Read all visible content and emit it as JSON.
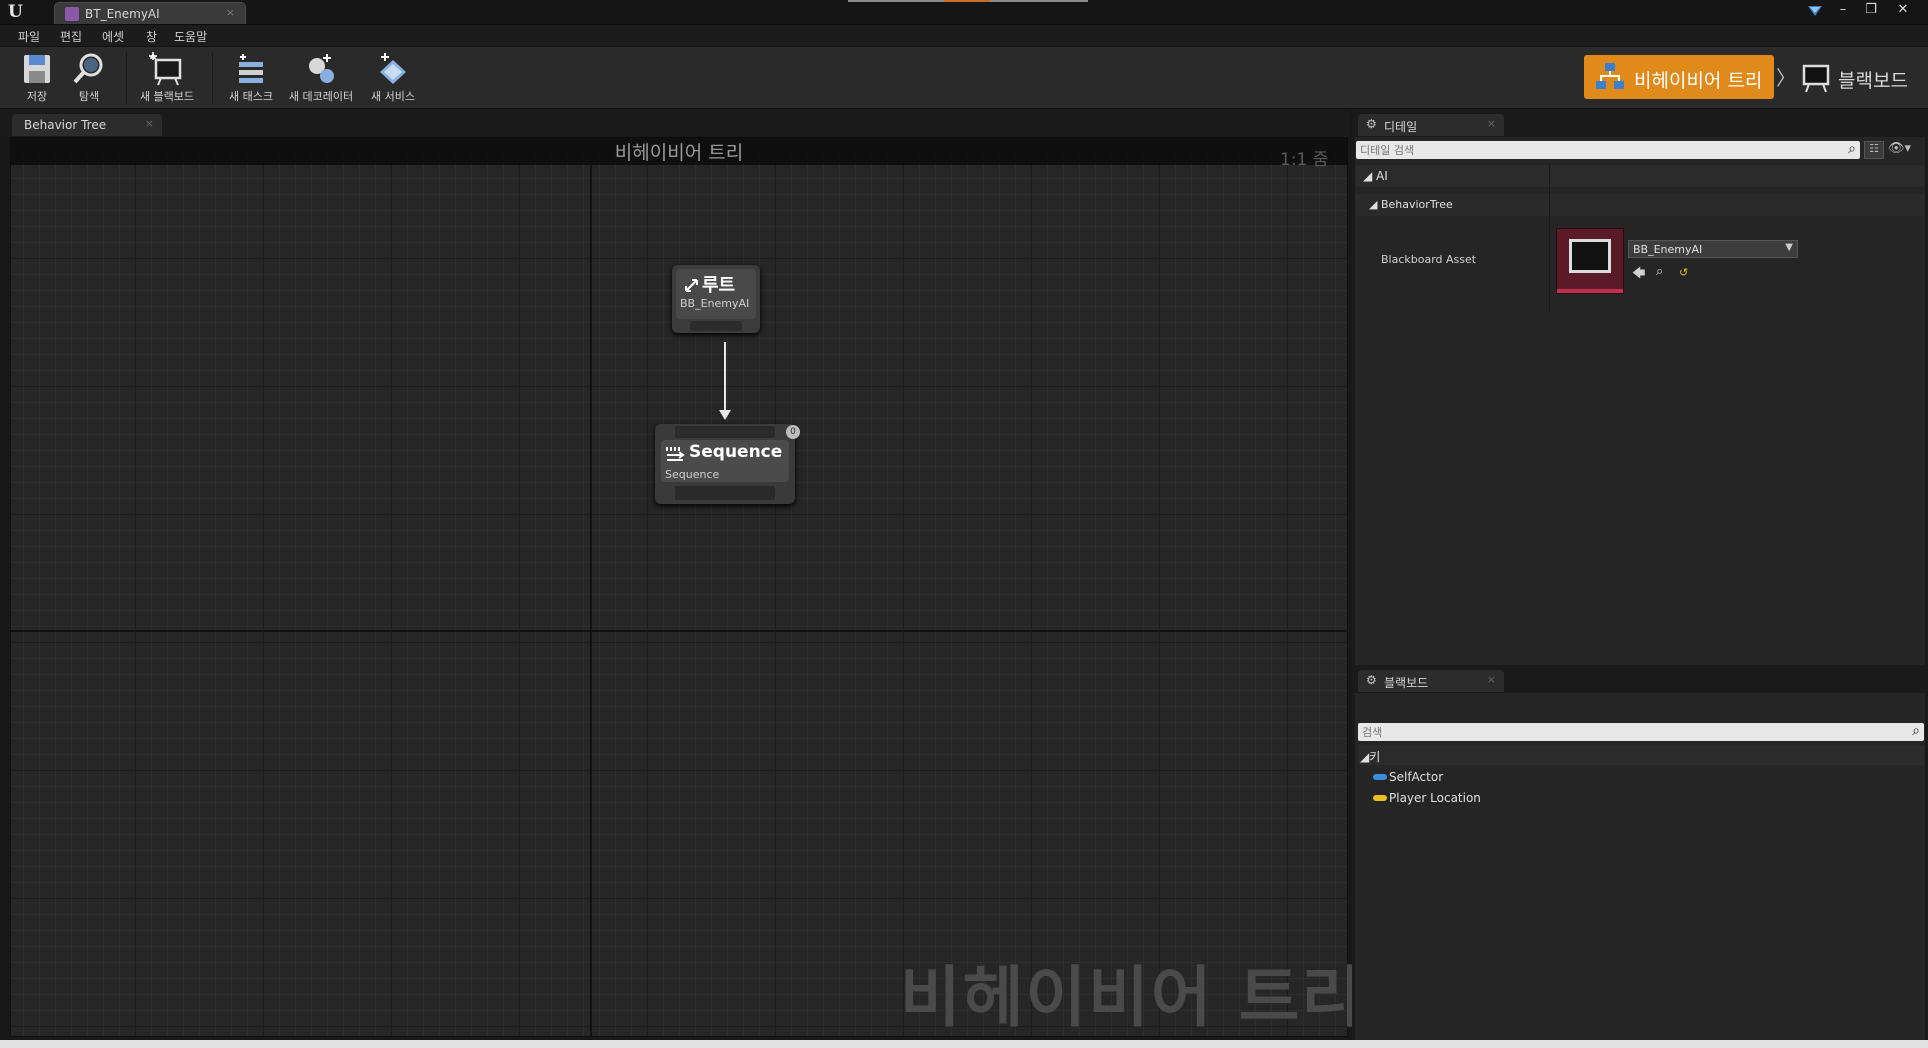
{
  "window": {
    "tab_title": "BT_EnemyAI",
    "tab_close": "×",
    "logo": "U",
    "controls": [
      "–",
      "❐",
      "✕"
    ]
  },
  "menu": [
    "파일",
    "편집",
    "에셋",
    "창",
    "도움말"
  ],
  "toolbar": {
    "buttons": [
      {
        "label": "저장",
        "icon": "save-icon"
      },
      {
        "label": "탐색",
        "icon": "browse-icon"
      },
      {
        "label": "새 블랙보드",
        "icon": "new-blackboard-icon"
      },
      {
        "label": "새 태스크",
        "icon": "new-task-icon"
      },
      {
        "label": "새 데코레이터",
        "icon": "new-decorator-icon"
      },
      {
        "label": "새 서비스",
        "icon": "new-service-icon"
      }
    ],
    "mode_active": "비헤이비어 트리",
    "mode_separator": "〉",
    "mode_other": "블랙보드",
    "accent_color": "#e08a1c"
  },
  "graph": {
    "tab_label": "Behavior Tree",
    "tab_close": "×",
    "header_title": "비헤이비어 트리",
    "zoom": "1:1 줌",
    "watermark": "비헤이비어 트리",
    "root_node": {
      "title": "루트",
      "subtitle": "BB_EnemyAI"
    },
    "sequence_node": {
      "title": "Sequence",
      "subtitle": "Sequence",
      "badge": "0"
    }
  },
  "details": {
    "tab_label": "디테일",
    "tab_close": "×",
    "search_placeholder": "디테일 검색",
    "categories": [
      "AI",
      "BehaviorTree"
    ],
    "property_label": "Blackboard Asset",
    "property_value": "BB_EnemyAI"
  },
  "blackboard": {
    "tab_label": "블랙보드",
    "tab_close": "×",
    "search_placeholder": "검색",
    "category": "키",
    "keys": [
      {
        "name": "SelfActor",
        "color": "#3a8ee0"
      },
      {
        "name": "Player Location",
        "color": "#e8c020"
      }
    ]
  }
}
